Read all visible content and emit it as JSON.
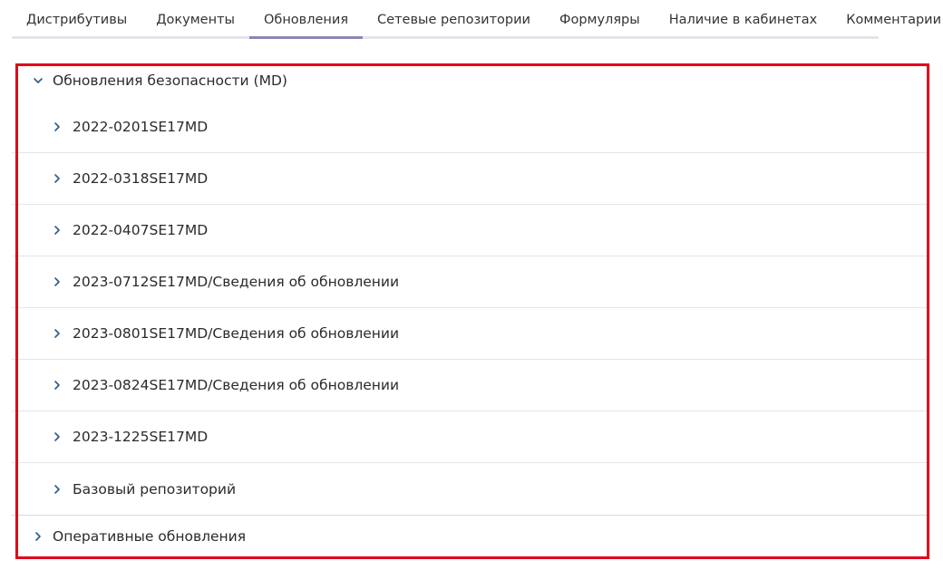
{
  "tabs": [
    {
      "label": "Дистрибутивы"
    },
    {
      "label": "Документы"
    },
    {
      "label": "Обновления"
    },
    {
      "label": "Сетевые репозитории"
    },
    {
      "label": "Формуляры"
    },
    {
      "label": "Наличие в кабинетах"
    },
    {
      "label": "Комментарии"
    }
  ],
  "active_tab": "Обновления",
  "tree": {
    "security_updates": {
      "label": "Обновления безопасности (MD)",
      "items": [
        {
          "label": "2022-0201SE17MD"
        },
        {
          "label": "2022-0318SE17MD"
        },
        {
          "label": "2022-0407SE17MD"
        },
        {
          "label": "2023-0712SE17MD/Сведения об обновлении"
        },
        {
          "label": "2023-0801SE17MD/Сведения об обновлении"
        },
        {
          "label": "2023-0824SE17MD/Сведения об обновлении"
        },
        {
          "label": "2023-1225SE17MD"
        },
        {
          "label": "Базовый репозиторий"
        }
      ]
    },
    "operative_updates": {
      "label": "Оперативные обновления"
    }
  },
  "colors": {
    "highlight_border": "#e3001b",
    "chevron": "#2d5a86",
    "active_tab_underline": "#8b87b4"
  }
}
